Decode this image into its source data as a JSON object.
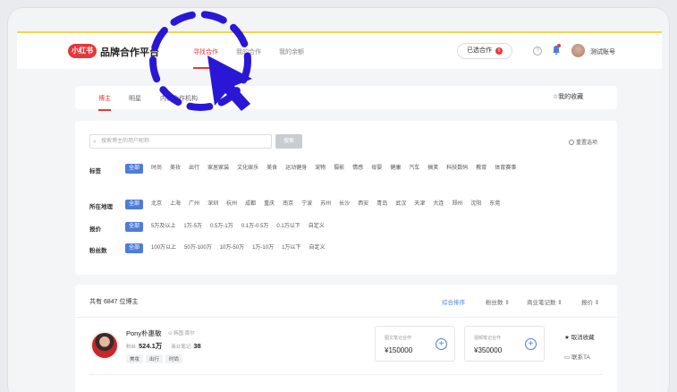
{
  "nav": {
    "logo_badge": "小红书",
    "logo_text": "品牌合作平台",
    "tabs": [
      "寻找合作",
      "我的合作",
      "我的余额"
    ],
    "selected_label": "已选合作",
    "selected_count": "0",
    "help": "?",
    "account_name": "测试账号"
  },
  "subtabs": {
    "items": [
      "博主",
      "明星",
      "内容合作机构"
    ],
    "favorites": "☆我的收藏"
  },
  "filter": {
    "search_placeholder": "搜索博主的用户昵称",
    "search_button": "搜索",
    "reset": "重置选项",
    "rows": [
      {
        "label": "标签",
        "options": [
          "全部",
          "时尚",
          "美妆",
          "出行",
          "家居家装",
          "文化娱乐",
          "美食",
          "运动健身",
          "宠物",
          "摄影",
          "情感",
          "母婴",
          "健康",
          "汽车",
          "搞笑",
          "科技数码",
          "教育",
          "体育赛事"
        ]
      },
      {
        "label": "所在地理",
        "options": [
          "全部",
          "北京",
          "上海",
          "广州",
          "深圳",
          "杭州",
          "成都",
          "重庆",
          "南京",
          "宁波",
          "苏州",
          "长沙",
          "西安",
          "青岛",
          "武汉",
          "天津",
          "大连",
          "郑州",
          "沈阳",
          "东莞"
        ]
      },
      {
        "label": "报价",
        "options": [
          "全部",
          "5万及以上",
          "1万-5万",
          "0.5万-1万",
          "0.1万-0.5万",
          "0.1万以下",
          "自定义"
        ]
      },
      {
        "label": "粉丝数",
        "options": [
          "全部",
          "100万以上",
          "50万-100万",
          "10万-50万",
          "1万-10万",
          "1万以下",
          "自定义"
        ]
      }
    ]
  },
  "results": {
    "total": "共有 6847 位博主",
    "sorts": [
      "综合排序",
      "粉丝数 ⇕",
      "商业笔记数 ⇕",
      "报价 ⇕"
    ],
    "kol": {
      "name": "Pony朴惠敏",
      "location": "⊙ 韩国 首尔",
      "fans_label": "粉丝",
      "fans": "524.1万",
      "notes_label": "商业笔记",
      "notes": "38",
      "tags": [
        "美妆",
        "出行",
        "时尚"
      ],
      "image_label": "图文笔记合作",
      "image_price": "¥150000",
      "video_label": "视频笔记合作",
      "video_price": "¥350000",
      "cancel_fav": "取消收藏",
      "contact": "联系TA"
    }
  },
  "colors": {
    "brand_red": "#e4393c",
    "accent_blue": "#4e7cd8",
    "annotation": "#2a17d6"
  }
}
